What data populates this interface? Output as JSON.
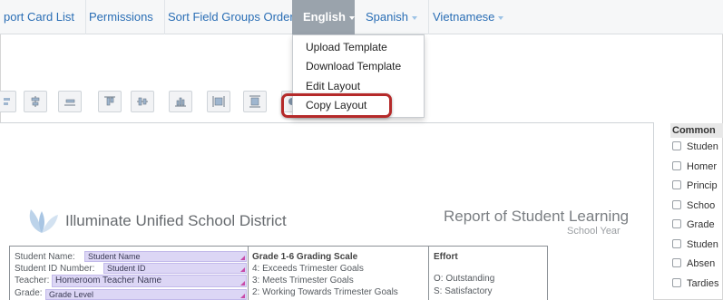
{
  "nav": {
    "tabs": [
      {
        "label": "port Card List"
      },
      {
        "label": "Permissions"
      },
      {
        "label": "Sort Field Groups Order"
      },
      {
        "label": "English"
      },
      {
        "label": "Spanish"
      },
      {
        "label": "Vietnamese"
      }
    ]
  },
  "language_menu": {
    "items": [
      {
        "label": "Upload Template"
      },
      {
        "label": "Download Template"
      },
      {
        "label": "Edit Layout"
      },
      {
        "label": "Copy Layout"
      }
    ],
    "highlighted": "Copy Layout",
    "highlight_color": "#b52a2a"
  },
  "toolbar": {
    "icons": [
      "align-left-icon",
      "align-center-icon",
      "align-bottom-icon",
      "align-top-icon",
      "align-middle-icon",
      "distribute-icon",
      "same-width-icon",
      "same-height-icon",
      "send-back-icon"
    ]
  },
  "report": {
    "district": "Illuminate Unified School District",
    "title": "Report of Student Learning",
    "school_year": "School Year",
    "labels": {
      "student_name": "Student Name:",
      "student_id": "Student ID Number:",
      "teacher": "Teacher:",
      "grade": "Grade:"
    },
    "fields": {
      "student_name": "Student Name",
      "student_id": "Student ID",
      "teacher": "Homeroom Teacher Name",
      "grade": "Grade Level"
    },
    "grading_scale": {
      "header": "Grade 1-6 Grading Scale",
      "rows": [
        "4: Exceeds Trimester Goals",
        "3: Meets Trimester Goals",
        "2: Working Towards Trimester Goals"
      ]
    },
    "effort": {
      "header": "Effort",
      "rows": [
        "O: Outstanding",
        "S: Satisfactory"
      ]
    }
  },
  "side_panel": {
    "heading": "Common",
    "items": [
      "Studen",
      "Homer",
      "Princip",
      "Schoo",
      "Grade",
      "Studen",
      "Absen",
      "Tardies"
    ]
  }
}
